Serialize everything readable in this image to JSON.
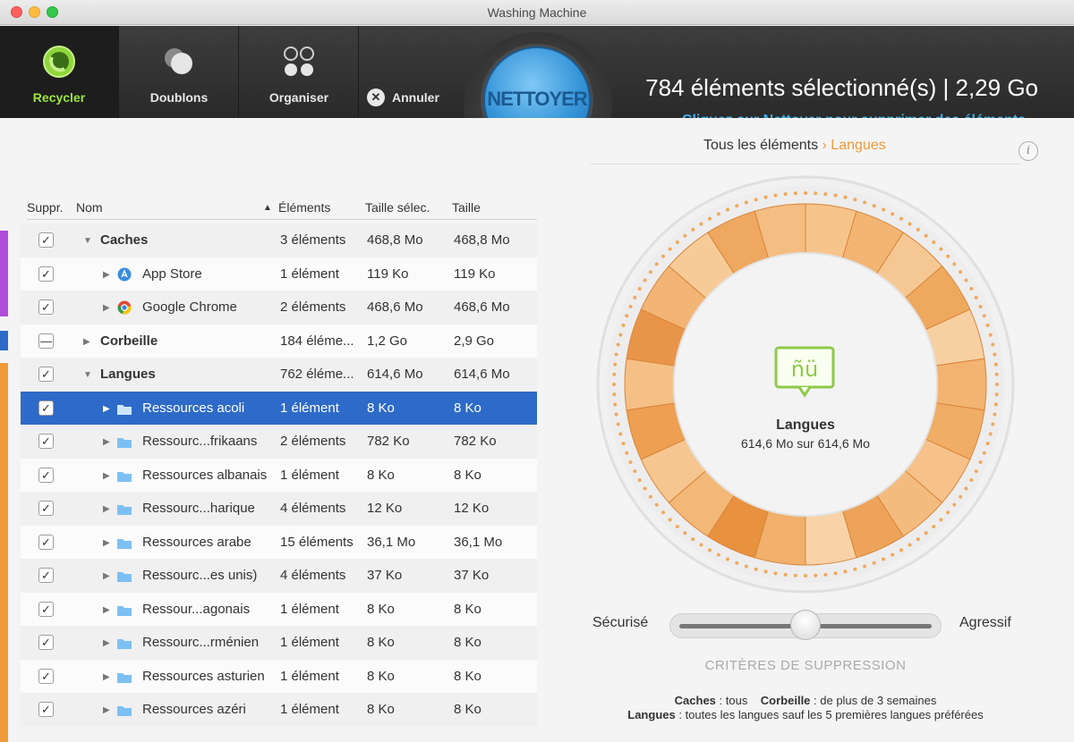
{
  "window": {
    "title": "Washing Machine"
  },
  "toolbar": {
    "tools": [
      {
        "label": "Recycler"
      },
      {
        "label": "Doublons"
      },
      {
        "label": "Organiser"
      }
    ],
    "cancel_label": "Annuler",
    "clean_label": "NETTOYER",
    "status_main": "784 éléments sélectionné(s) | 2,29 Go",
    "status_sub": "Cliquez sur Nettoyer pour supprimer des éléments"
  },
  "table": {
    "headers": {
      "suppr": "Suppr.",
      "name": "Nom",
      "elements": "Éléments",
      "size_sel": "Taille sélec.",
      "size": "Taille"
    },
    "rows": [
      {
        "name": "Caches",
        "elements": "3 éléments",
        "size_sel": "468,8 Mo",
        "size": "468,8 Mo",
        "level": 0,
        "checked": "checked"
      },
      {
        "name": "App Store",
        "elements": "1 élément",
        "size_sel": "119 Ko",
        "size": "119 Ko",
        "level": 1,
        "checked": "checked",
        "icon": "app-store-icon"
      },
      {
        "name": "Google Chrome",
        "elements": "2 éléments",
        "size_sel": "468,6 Mo",
        "size": "468,6 Mo",
        "level": 1,
        "checked": "checked",
        "icon": "chrome-icon"
      },
      {
        "name": "Corbeille",
        "elements": "184 éléme...",
        "size_sel": "1,2 Go",
        "size": "2,9 Go",
        "level": 0,
        "checked": "mixed"
      },
      {
        "name": "Langues",
        "elements": "762 éléme...",
        "size_sel": "614,6 Mo",
        "size": "614,6 Mo",
        "level": 0,
        "checked": "checked"
      },
      {
        "name": "Ressources acoli",
        "elements": "1 élément",
        "size_sel": "8 Ko",
        "size": "8 Ko",
        "level": 1,
        "checked": "checked",
        "icon": "folder-icon",
        "selected": true
      },
      {
        "name": "Ressourc...frikaans",
        "elements": "2 éléments",
        "size_sel": "782 Ko",
        "size": "782 Ko",
        "level": 1,
        "checked": "checked",
        "icon": "folder-icon"
      },
      {
        "name": "Ressources albanais",
        "elements": "1 élément",
        "size_sel": "8 Ko",
        "size": "8 Ko",
        "level": 1,
        "checked": "checked",
        "icon": "folder-icon"
      },
      {
        "name": "Ressourc...harique",
        "elements": "4 éléments",
        "size_sel": "12 Ko",
        "size": "12 Ko",
        "level": 1,
        "checked": "checked",
        "icon": "folder-icon"
      },
      {
        "name": "Ressources arabe",
        "elements": "15 éléments",
        "size_sel": "36,1 Mo",
        "size": "36,1 Mo",
        "level": 1,
        "checked": "checked",
        "icon": "folder-icon"
      },
      {
        "name": "Ressourc...es unis)",
        "elements": "4 éléments",
        "size_sel": "37 Ko",
        "size": "37 Ko",
        "level": 1,
        "checked": "checked",
        "icon": "folder-icon"
      },
      {
        "name": "Ressour...agonais",
        "elements": "1 élément",
        "size_sel": "8 Ko",
        "size": "8 Ko",
        "level": 1,
        "checked": "checked",
        "icon": "folder-icon"
      },
      {
        "name": "Ressourc...rménien",
        "elements": "1 élément",
        "size_sel": "8 Ko",
        "size": "8 Ko",
        "level": 1,
        "checked": "checked",
        "icon": "folder-icon"
      },
      {
        "name": "Ressources asturien",
        "elements": "1 élément",
        "size_sel": "8 Ko",
        "size": "8 Ko",
        "level": 1,
        "checked": "checked",
        "icon": "folder-icon"
      },
      {
        "name": "Ressources azéri",
        "elements": "1 élément",
        "size_sel": "8 Ko",
        "size": "8 Ko",
        "level": 1,
        "checked": "checked",
        "icon": "folder-icon"
      }
    ]
  },
  "breadcrumb": {
    "root": "Tous les éléments",
    "separator": "›",
    "current": "Langues"
  },
  "dial": {
    "title": "Langues",
    "subtitle": "614,6 Mo sur 614,6 Mo"
  },
  "slider": {
    "left_label": "Sécurisé",
    "right_label": "Agressif",
    "value": 0.5
  },
  "criteria": {
    "heading": "CRITÈRES DE SUPPRESSION",
    "caches_label": "Caches",
    "caches_value": " : tous",
    "trash_label": "Corbeille",
    "trash_value": " : de plus de 3 semaines",
    "langs_label": "Langues",
    "langs_value": " : toutes les langues sauf les 5 premières langues préférées"
  },
  "colors": {
    "accent_green": "#9be63a",
    "link_blue": "#3fb1ee",
    "selection_blue": "#2e6ac8",
    "orange": "#f09a3a",
    "purple_bar": "#b04ddb",
    "blue_bar": "#2e6ac8"
  }
}
